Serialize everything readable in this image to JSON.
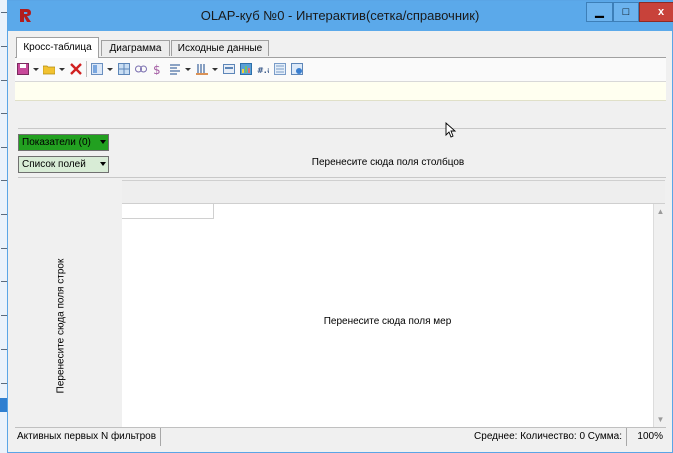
{
  "window": {
    "title": "OLAP-куб №0 - Интерактив(сетка/справочник)",
    "min_label": "▁",
    "max_label": "□",
    "close_label": "x"
  },
  "tabs": [
    {
      "label": "Кросс-таблица",
      "active": true
    },
    {
      "label": "Диаграмма",
      "active": false
    },
    {
      "label": "Исходные данные",
      "active": false
    }
  ],
  "toolbar": {
    "icons": [
      "save-icon",
      "open-folder-icon",
      "delete-icon",
      "layout-icon",
      "grid-icon",
      "collapse-icon",
      "sum-icon",
      "align-icon",
      "column-icon",
      "export-icon",
      "chart-icon",
      "format-icon",
      "filter-icon",
      "info-icon"
    ]
  },
  "pivot": {
    "measures_combo": "Показатели (0)",
    "fields_combo": "Список полей",
    "column_drop_text": "Перенесите сюда поля столбцов",
    "row_drop_text": "Перенесите сюда поля строк",
    "data_drop_text": "Перенесите сюда поля мер"
  },
  "status": {
    "filter_text": "Активных первых N фильтров",
    "summary_text": "Среднее:  Количество: 0  Сумма:",
    "zoom": "100%"
  },
  "colors": {
    "titlebar": "#5ba9ea",
    "measures_combo": "#22a020",
    "fields_combo": "#d8ecd6",
    "close_button": "#c8423a"
  }
}
